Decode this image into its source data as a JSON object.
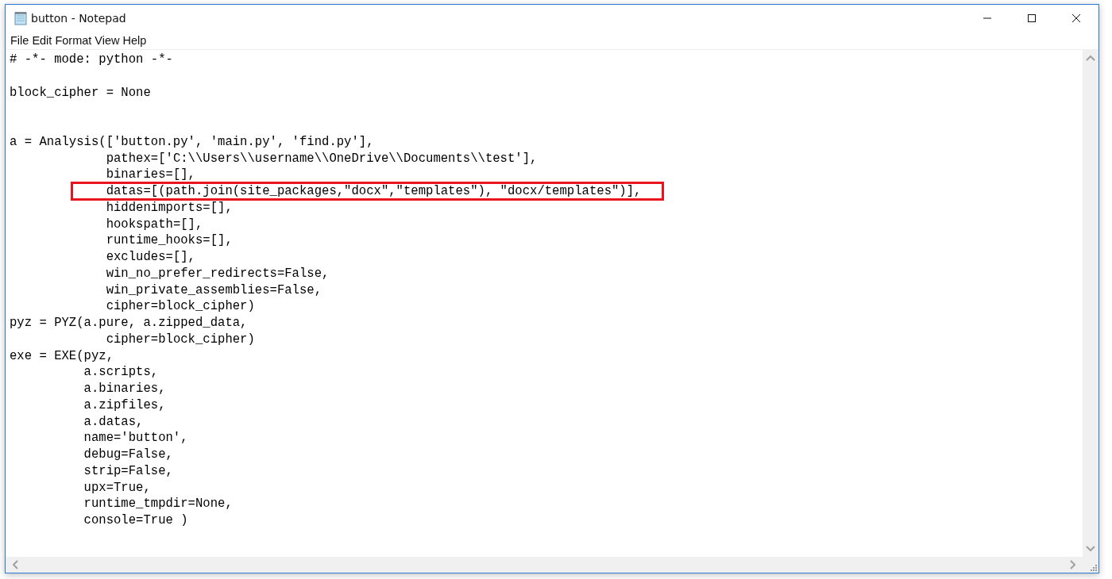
{
  "window": {
    "title": "button - Notepad"
  },
  "menu": [
    {
      "label": "File"
    },
    {
      "label": "Edit"
    },
    {
      "label": "Format"
    },
    {
      "label": "View"
    },
    {
      "label": "Help"
    }
  ],
  "editor": {
    "lines": [
      {
        "kind": "code",
        "text": "# -*- mode: python -*-",
        "highlighted": false
      },
      {
        "kind": "blank"
      },
      {
        "kind": "code",
        "text": "block_cipher = None",
        "highlighted": false
      },
      {
        "kind": "blank"
      },
      {
        "kind": "blank"
      },
      {
        "kind": "code",
        "text": "a = Analysis(['button.py', 'main.py', 'find.py'],",
        "highlighted": false
      },
      {
        "kind": "code",
        "text": "             pathex=['C:\\\\Users\\\\username\\\\OneDrive\\\\Documents\\\\test'],",
        "highlighted": false
      },
      {
        "kind": "code",
        "text": "             binaries=[],",
        "highlighted": false
      },
      {
        "kind": "code",
        "text": "             datas=[(path.join(site_packages,\"docx\",\"templates\"), \"docx/templates\")],",
        "highlighted": true
      },
      {
        "kind": "code",
        "text": "             hiddenimports=[],",
        "highlighted": false
      },
      {
        "kind": "code",
        "text": "             hookspath=[],",
        "highlighted": false
      },
      {
        "kind": "code",
        "text": "             runtime_hooks=[],",
        "highlighted": false
      },
      {
        "kind": "code",
        "text": "             excludes=[],",
        "highlighted": false
      },
      {
        "kind": "code",
        "text": "             win_no_prefer_redirects=False,",
        "highlighted": false
      },
      {
        "kind": "code",
        "text": "             win_private_assemblies=False,",
        "highlighted": false
      },
      {
        "kind": "code",
        "text": "             cipher=block_cipher)",
        "highlighted": false
      },
      {
        "kind": "code",
        "text": "pyz = PYZ(a.pure, a.zipped_data,",
        "highlighted": false
      },
      {
        "kind": "code",
        "text": "             cipher=block_cipher)",
        "highlighted": false
      },
      {
        "kind": "code",
        "text": "exe = EXE(pyz,",
        "highlighted": false
      },
      {
        "kind": "code",
        "text": "          a.scripts,",
        "highlighted": false
      },
      {
        "kind": "code",
        "text": "          a.binaries,",
        "highlighted": false
      },
      {
        "kind": "code",
        "text": "          a.zipfiles,",
        "highlighted": false
      },
      {
        "kind": "code",
        "text": "          a.datas,",
        "highlighted": false
      },
      {
        "kind": "code",
        "text": "          name='button',",
        "highlighted": false
      },
      {
        "kind": "code",
        "text": "          debug=False,",
        "highlighted": false
      },
      {
        "kind": "code",
        "text": "          strip=False,",
        "highlighted": false
      },
      {
        "kind": "code",
        "text": "          upx=True,",
        "highlighted": false
      },
      {
        "kind": "code",
        "text": "          runtime_tmpdir=None,",
        "highlighted": false
      },
      {
        "kind": "code",
        "text": "          console=True )",
        "highlighted": false
      }
    ]
  }
}
